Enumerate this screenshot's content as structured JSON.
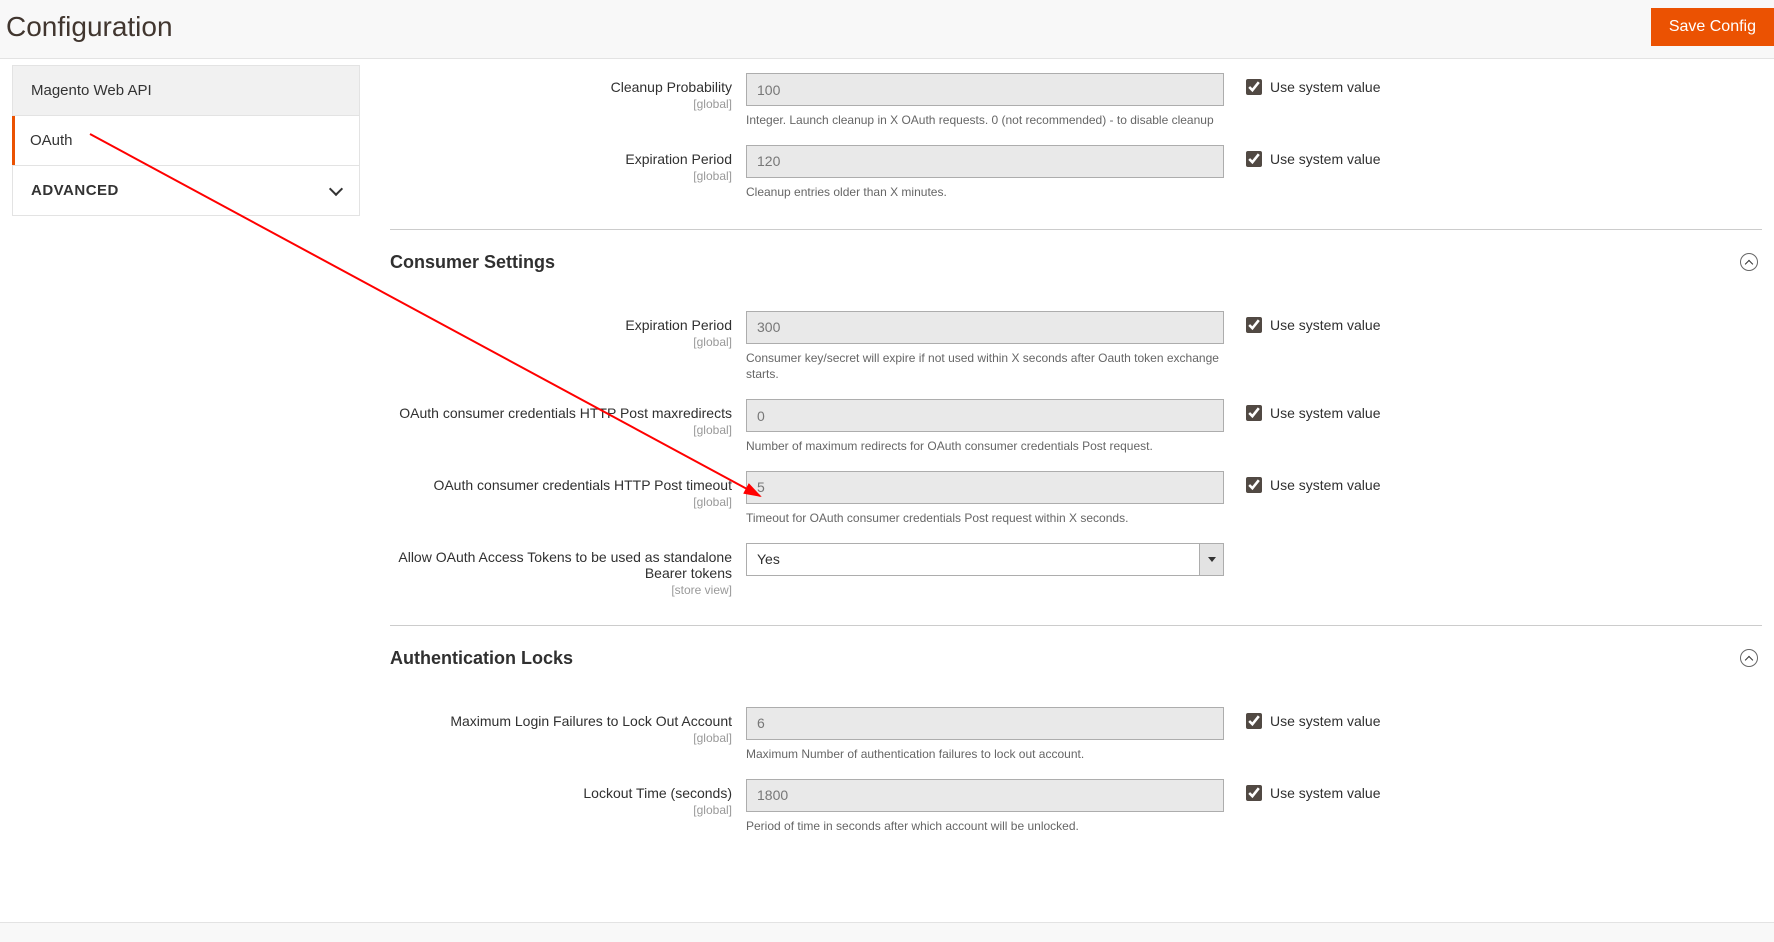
{
  "header": {
    "title": "Configuration",
    "save_label": "Save Config"
  },
  "sidebar": {
    "item_web_api": "Magento Web API",
    "item_oauth": "OAuth",
    "item_advanced": "ADVANCED"
  },
  "sections": {
    "top": {
      "cleanup_prob": {
        "label": "Cleanup Probability",
        "scope": "[global]",
        "value": "100",
        "hint": "Integer. Launch cleanup in X OAuth requests. 0 (not recommended) - to disable cleanup"
      },
      "expiration": {
        "label": "Expiration Period",
        "scope": "[global]",
        "value": "120",
        "hint": "Cleanup entries older than X minutes."
      }
    },
    "consumer": {
      "title": "Consumer Settings",
      "expiration": {
        "label": "Expiration Period",
        "scope": "[global]",
        "value": "300",
        "hint": "Consumer key/secret will expire if not used within X seconds after Oauth token exchange starts."
      },
      "maxredirects": {
        "label": "OAuth consumer credentials HTTP Post maxredirects",
        "scope": "[global]",
        "value": "0",
        "hint": "Number of maximum redirects for OAuth consumer credentials Post request."
      },
      "timeout": {
        "label": "OAuth consumer credentials HTTP Post timeout",
        "scope": "[global]",
        "value": "5",
        "hint": "Timeout for OAuth consumer credentials Post request within X seconds."
      },
      "bearer": {
        "label": "Allow OAuth Access Tokens to be used as standalone Bearer tokens",
        "scope": "[store view]",
        "value": "Yes"
      }
    },
    "auth_locks": {
      "title": "Authentication Locks",
      "max_fail": {
        "label": "Maximum Login Failures to Lock Out Account",
        "scope": "[global]",
        "value": "6",
        "hint": "Maximum Number of authentication failures to lock out account."
      },
      "lockout": {
        "label": "Lockout Time (seconds)",
        "scope": "[global]",
        "value": "1800",
        "hint": "Period of time in seconds after which account will be unlocked."
      }
    }
  },
  "use_system_value": "Use system value"
}
